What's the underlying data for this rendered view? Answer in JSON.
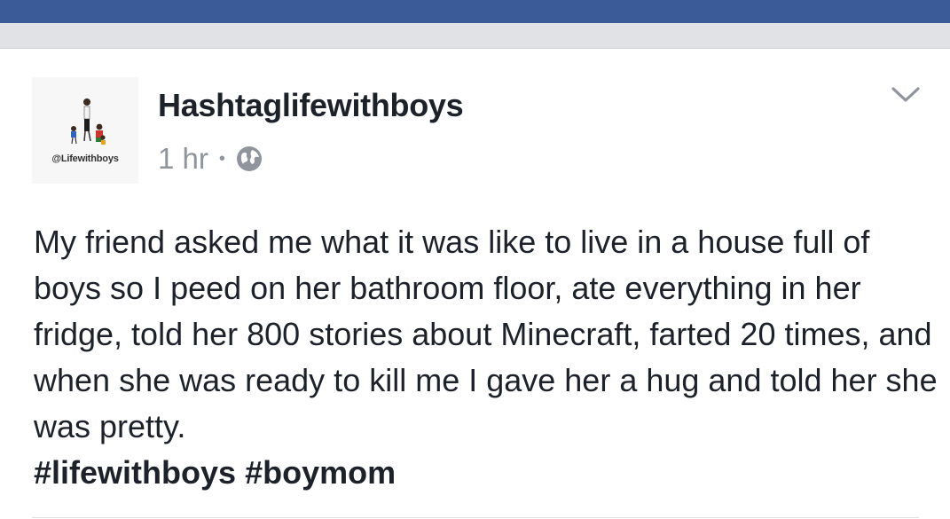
{
  "header": {
    "bar_color": "#3b5a98"
  },
  "post": {
    "page_name": "Hashtaglifewithboys",
    "avatar_caption": "@Lifewithboys",
    "timestamp": "1 hr",
    "separator": "•",
    "privacy_icon": "globe-icon",
    "menu_icon": "chevron-down-icon",
    "body": "My friend asked me what it was like to live in a house full of boys so I peed on her bathroom floor, ate everything in her fridge, told her 800 stories about Minecraft, farted 20 times, and when she was ready to kill me I gave her a hug and told her she was pretty.",
    "hashtags": [
      "#lifewithboys",
      "#boymom"
    ]
  }
}
